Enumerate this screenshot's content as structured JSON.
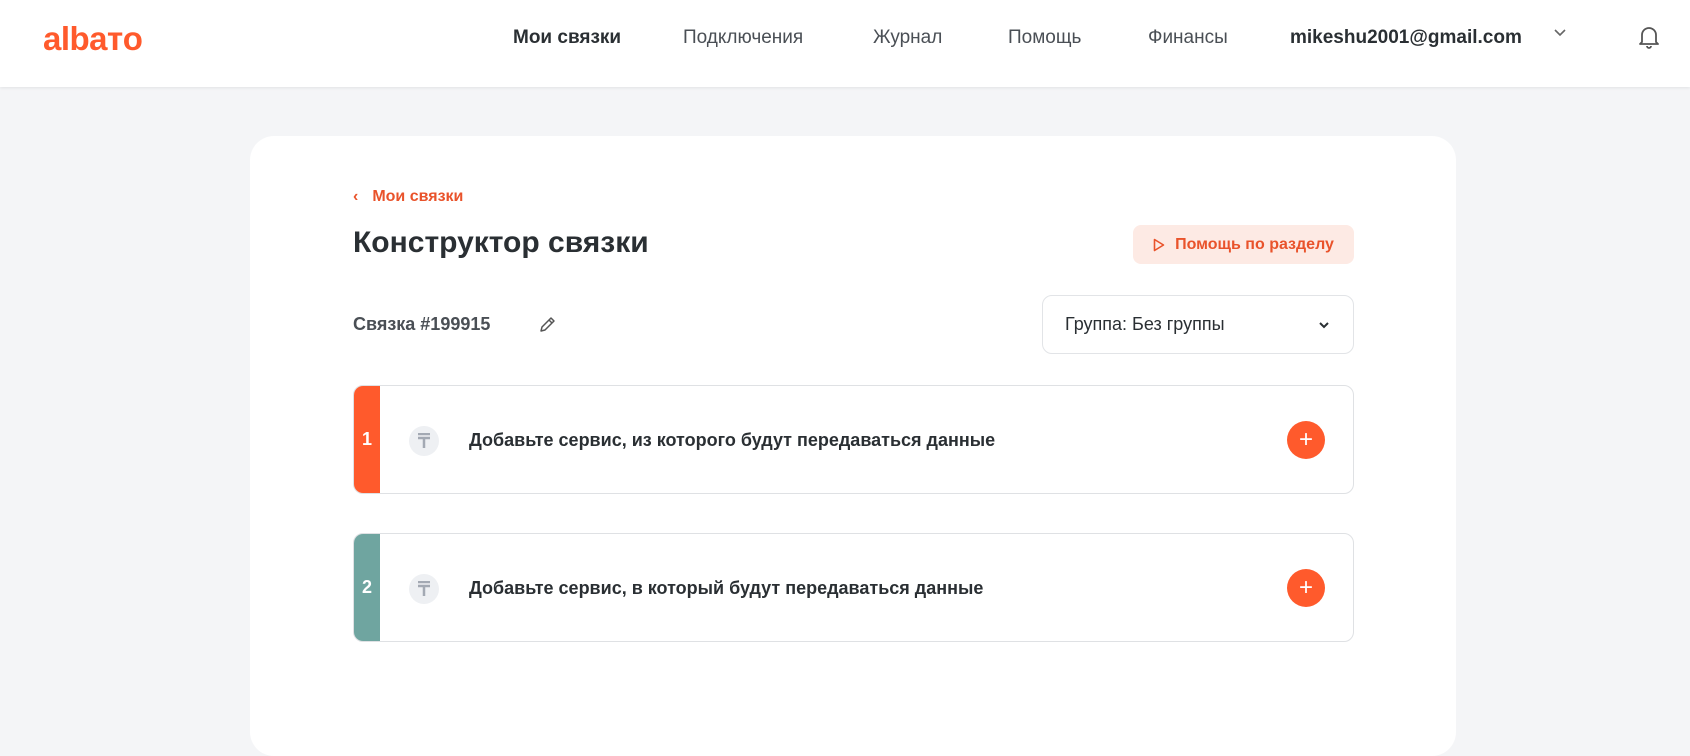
{
  "header": {
    "logo": "albaтo",
    "nav": [
      "Мои связки",
      "Подключения",
      "Журнал",
      "Помощь",
      "Финансы"
    ],
    "email": "mikeshu2001@gmail.com"
  },
  "breadcrumb": "Мои связки",
  "title": "Конструктор связки",
  "help_button": "Помощь по разделу",
  "link_name": "Связка #199915",
  "group_select": "Группа: Без группы",
  "steps": [
    {
      "number": "1",
      "text": "Добавьте сервис, из которого будут передаваться данные",
      "color": "#ff5a2c"
    },
    {
      "number": "2",
      "text": "Добавьте сервис, в который будут передаваться данные",
      "color": "#6fa5a0"
    }
  ]
}
